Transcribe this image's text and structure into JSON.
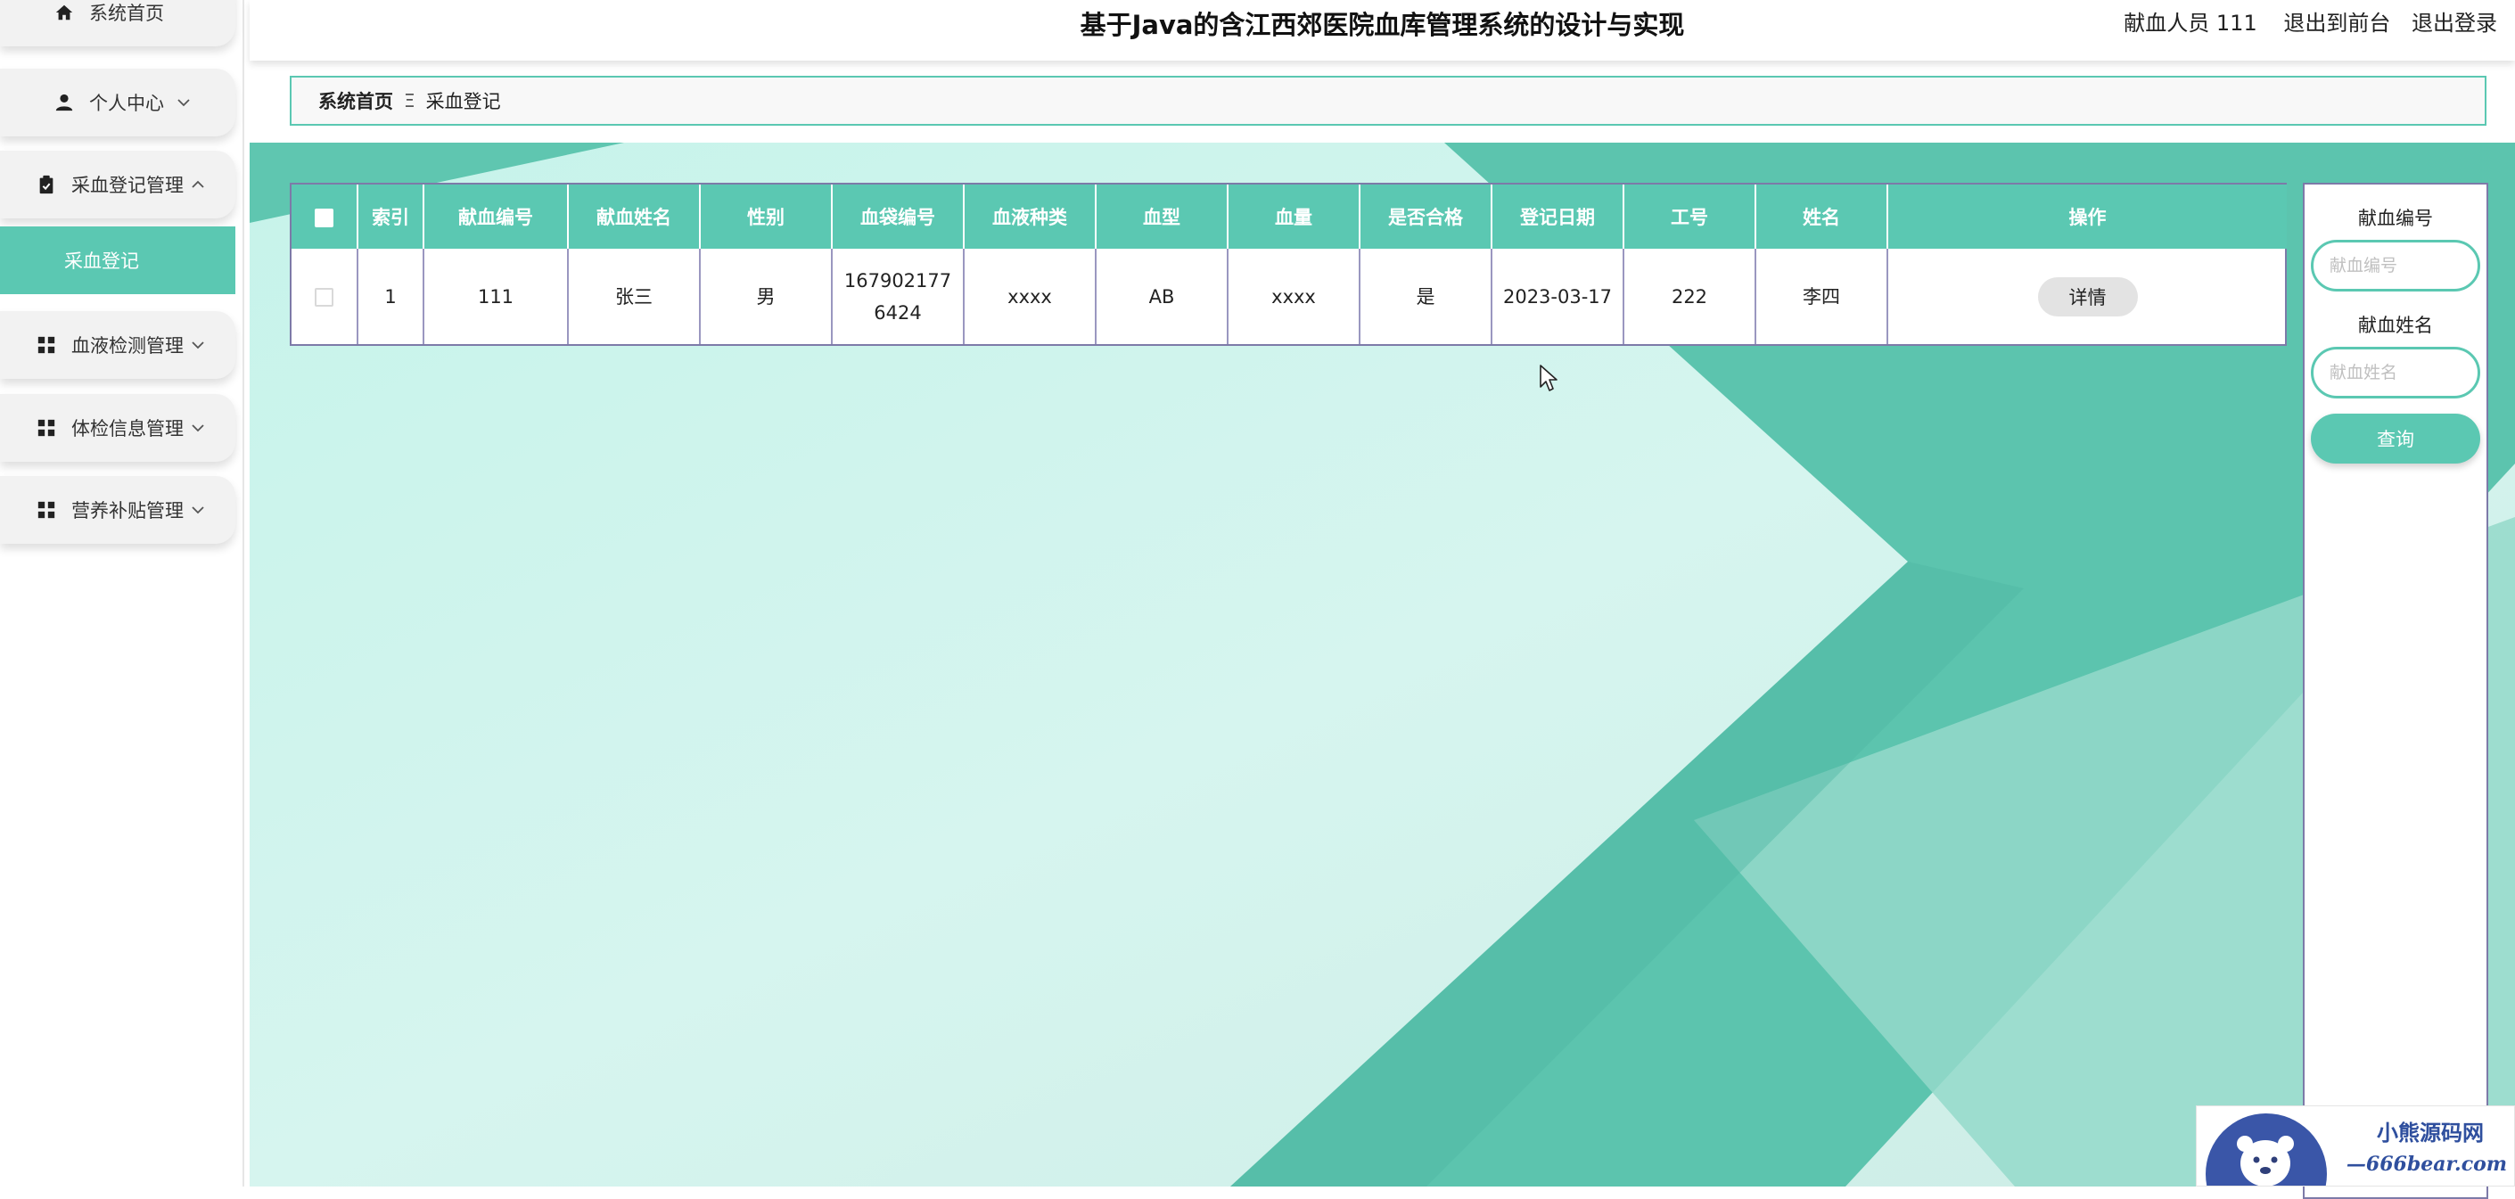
{
  "header": {
    "title": "基于Java的含江西郊医院血库管理系统的设计与实现",
    "user": "献血人员 111",
    "exit_front": "退出到前台",
    "logout": "退出登录"
  },
  "sidebar": {
    "items": [
      {
        "label": "系统首页",
        "icon": "home-icon"
      },
      {
        "label": "个人中心",
        "icon": "user-icon"
      },
      {
        "label": "采血登记管理",
        "icon": "clipboard-icon",
        "expanded": true
      },
      {
        "label": "血液检测管理",
        "icon": "grid-icon"
      },
      {
        "label": "体检信息管理",
        "icon": "grid-icon"
      },
      {
        "label": "营养补贴管理",
        "icon": "grid-icon"
      }
    ],
    "active_sub": "采血登记"
  },
  "breadcrumb": {
    "home": "系统首页",
    "separator": "Ξ",
    "current": "采血登记"
  },
  "table": {
    "columns": [
      "索引",
      "献血编号",
      "献血姓名",
      "性别",
      "血袋编号",
      "血液种类",
      "血型",
      "血量",
      "是否合格",
      "登记日期",
      "工号",
      "姓名",
      "操作"
    ],
    "rows": [
      {
        "index": "1",
        "donor_no": "111",
        "donor_name": "张三",
        "gender": "男",
        "bag_no_line1": "167902177",
        "bag_no_line2": "6424",
        "blood_kind": "xxxx",
        "blood_type": "AB",
        "volume": "xxxx",
        "qualified": "是",
        "date": "2023-03-17",
        "staff_no": "222",
        "name": "李四",
        "action": "详情"
      }
    ]
  },
  "search": {
    "donor_no_label": "献血编号",
    "donor_no_placeholder": "献血编号",
    "donor_name_label": "献血姓名",
    "donor_name_placeholder": "献血姓名",
    "button": "查询"
  },
  "watermark": {
    "title": "小熊源码网",
    "url": "—666bear.com—"
  },
  "colors": {
    "accent": "#5bc8b2",
    "background_light": "#ccf3ec",
    "background_dark": "#5cc4ae",
    "border": "#7d7aa8"
  }
}
